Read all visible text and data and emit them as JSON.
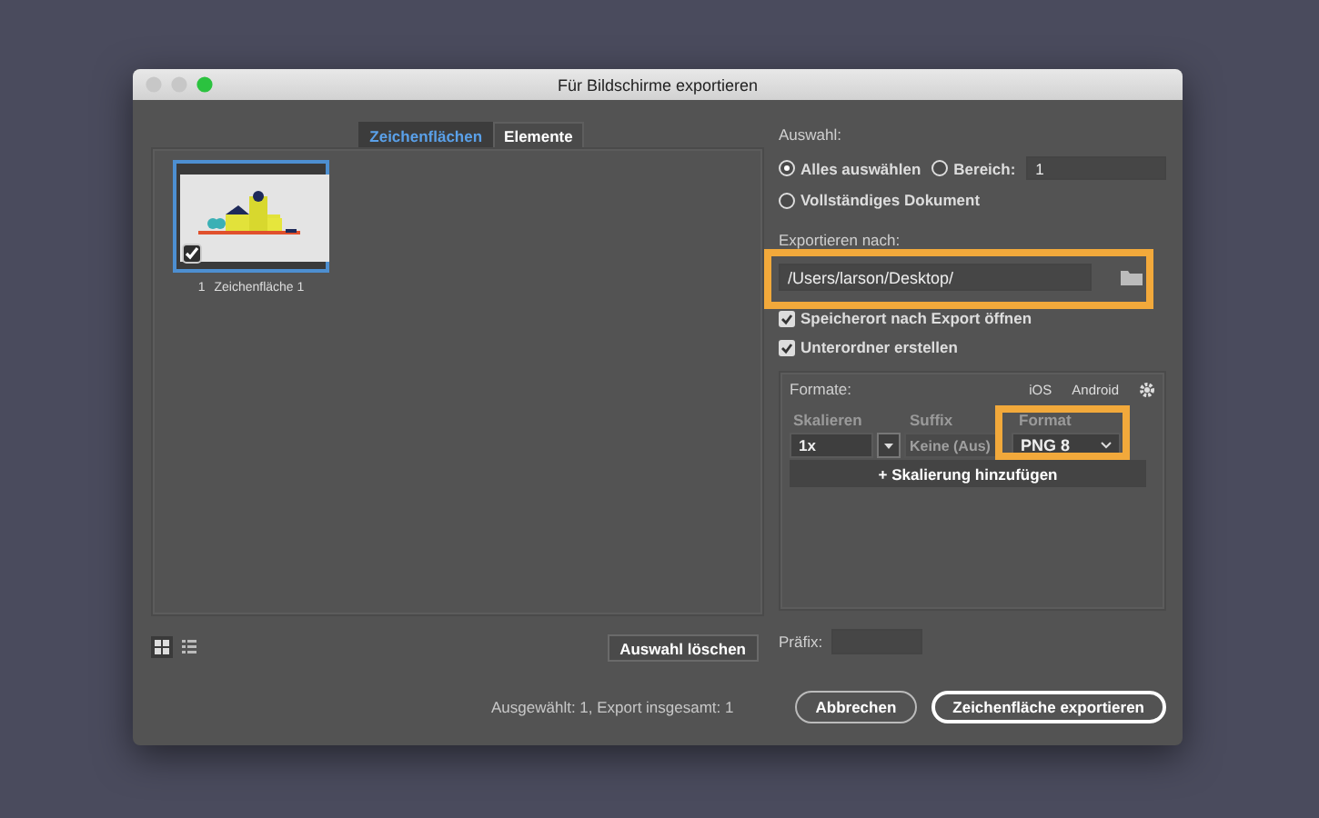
{
  "window": {
    "title": "Für Bildschirme exportieren"
  },
  "tabs": [
    {
      "label": "Zeichenflächen",
      "selected": true
    },
    {
      "label": "Elemente",
      "selected": false
    }
  ],
  "artboards": [
    {
      "number": "1",
      "name": "Zeichenfläche 1",
      "checked": true,
      "selected": true
    }
  ],
  "view_modes": [
    {
      "kind": "grid",
      "selected": true
    },
    {
      "kind": "list",
      "selected": false
    }
  ],
  "clear_button": "Auswahl löschen",
  "selection": {
    "label": "Auswahl:",
    "options": [
      {
        "label": "Alles auswählen",
        "selected": true
      },
      {
        "label": "Bereich:",
        "selected": false
      },
      {
        "label": "Vollständiges Dokument",
        "selected": false
      }
    ],
    "range_value": "1"
  },
  "export_to": {
    "label": "Exportieren nach:",
    "path": "/Users/larson/Desktop/",
    "highlighted": true
  },
  "options": [
    {
      "label": "Speicherort nach Export öffnen",
      "checked": true
    },
    {
      "label": "Unterordner erstellen",
      "checked": true
    }
  ],
  "formats": {
    "label": "Formate:",
    "presets": [
      "iOS",
      "Android"
    ],
    "columns": [
      "Skalieren",
      "Suffix",
      "Format"
    ],
    "rows": [
      {
        "scale": "1x",
        "suffix_placeholder": "Keine (Aus)",
        "format": "PNG 8",
        "format_highlighted": true
      }
    ],
    "add_button": "+ Skalierung hinzufügen"
  },
  "prefix": {
    "label": "Präfix:"
  },
  "status": "Ausgewählt: 1, Export insgesamt: 1",
  "buttons": [
    "Abbrechen",
    "Zeichenfläche exportieren"
  ]
}
